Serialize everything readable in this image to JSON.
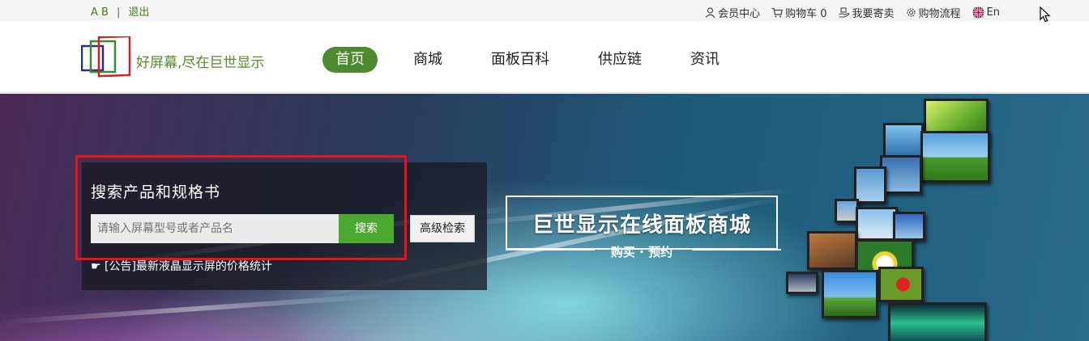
{
  "topbar": {
    "lang_switch": "A B",
    "separator": "|",
    "logout": "退出",
    "links": [
      {
        "icon": "user-icon",
        "label": "会员中心"
      },
      {
        "icon": "cart-icon",
        "label": "购物车 0"
      },
      {
        "icon": "sell-hand-icon",
        "label": "我要寄卖"
      },
      {
        "icon": "gear-icon",
        "label": "购物流程"
      },
      {
        "icon": "uk-flag-icon",
        "label": "En"
      }
    ]
  },
  "header": {
    "slogan": "好屏幕,尽在巨世显示",
    "nav": [
      "首页",
      "商城",
      "面板百科",
      "供应链",
      "资讯"
    ],
    "active_nav": "首页"
  },
  "search": {
    "title": "搜索产品和规格书",
    "placeholder": "请输入屏幕型号或者产品名",
    "button": "搜索",
    "advanced_button": "高级检索",
    "notice": "☛ [公告]最新液晶显示屏的价格统计"
  },
  "promo": {
    "title": "巨世显示在线面板商城",
    "subtitle": "购买 · 预约"
  },
  "colors": {
    "brand_green": "#4e8a2f",
    "search_green": "#4aa92e",
    "highlight_red": "#e11111"
  }
}
